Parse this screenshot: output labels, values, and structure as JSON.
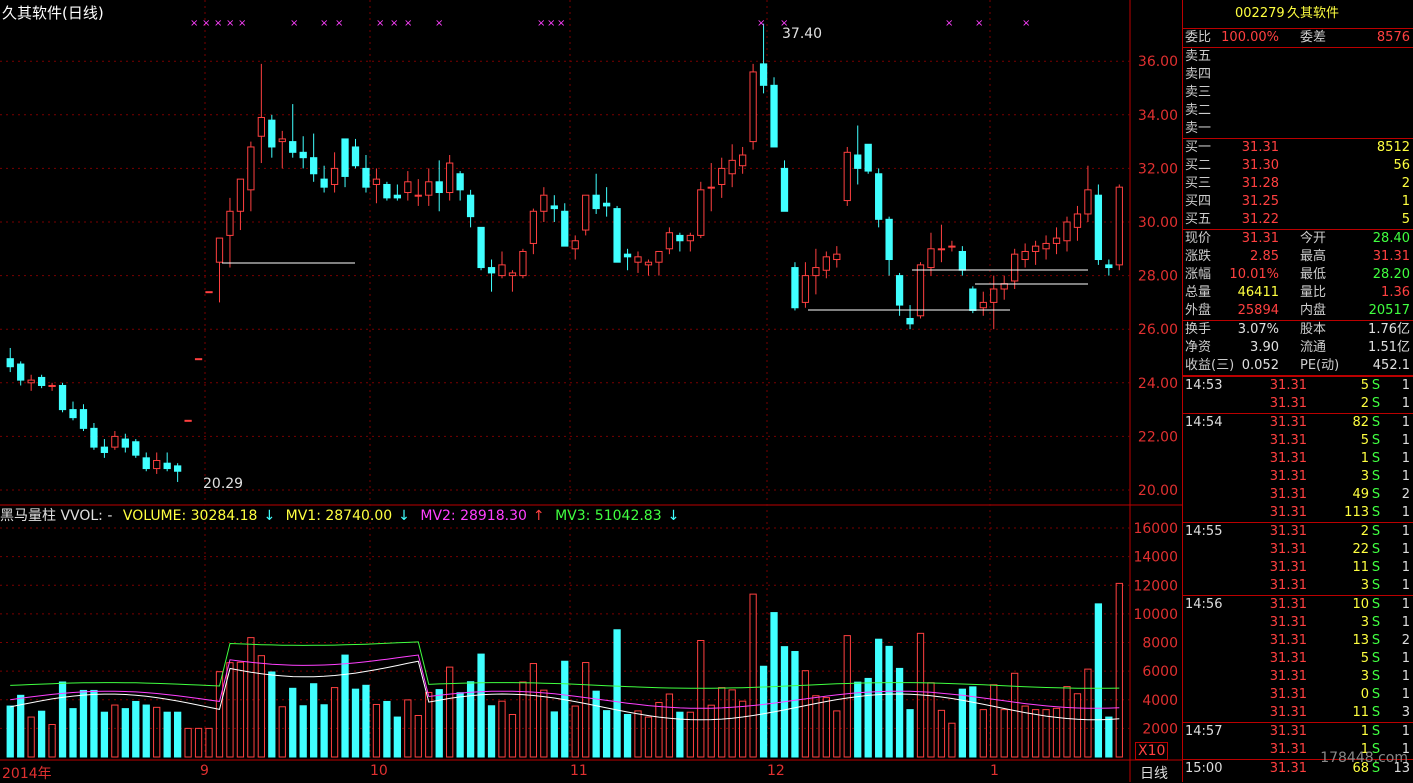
{
  "title": "久其软件(日线)",
  "vol_legend": {
    "name": "黑马量柱 VVOL: -",
    "volume": "VOLUME: 30284.18",
    "mv1": "MV1: 28740.00",
    "mv2": "MV2: 28918.30",
    "mv3": "MV3: 51042.83",
    "colors": {
      "volume": "#ffff40",
      "mv1": "#ffff40",
      "mv2": "#ff40ff",
      "mv3": "#40ff40"
    }
  },
  "annotations": {
    "high": "37.40",
    "low": "20.29"
  },
  "x_labels": [
    "2014年",
    "9",
    "10",
    "11",
    "12",
    "1"
  ],
  "period_label": "日线",
  "x10_label": "X10",
  "price_axis": [
    "36.00",
    "34.00",
    "32.00",
    "30.00",
    "28.00",
    "26.00",
    "24.00",
    "22.00",
    "20.00"
  ],
  "vol_axis": [
    "16000",
    "14000",
    "12000",
    "10000",
    "8000",
    "6000",
    "4000",
    "2000"
  ],
  "chart_data": {
    "type": "candlestick",
    "price_range": [
      20,
      37.4
    ],
    "series": [
      [
        24.9,
        25.3,
        24.4,
        24.6
      ],
      [
        24.7,
        24.8,
        23.9,
        24.1
      ],
      [
        24.0,
        24.3,
        23.7,
        24.1
      ],
      [
        24.2,
        24.3,
        23.8,
        23.9
      ],
      [
        23.9,
        24.0,
        23.7,
        23.9
      ],
      [
        23.9,
        24.0,
        22.9,
        23.0
      ],
      [
        23.0,
        23.3,
        22.6,
        22.7
      ],
      [
        23.0,
        23.2,
        22.2,
        22.3
      ],
      [
        22.3,
        22.5,
        21.5,
        21.6
      ],
      [
        21.6,
        21.9,
        21.2,
        21.4
      ],
      [
        21.6,
        22.2,
        21.5,
        22.0
      ],
      [
        21.9,
        22.1,
        21.4,
        21.6
      ],
      [
        21.8,
        21.9,
        21.2,
        21.3
      ],
      [
        21.2,
        21.4,
        20.7,
        20.8
      ],
      [
        20.8,
        21.4,
        20.6,
        21.1
      ],
      [
        21.0,
        21.4,
        20.7,
        20.8
      ],
      [
        20.9,
        21.0,
        20.3,
        20.7
      ],
      [
        22.6,
        22.6,
        22.6,
        22.6
      ],
      [
        24.9,
        24.9,
        24.9,
        24.9
      ],
      [
        27.4,
        27.4,
        27.4,
        27.4
      ],
      [
        28.5,
        28.9,
        27.0,
        29.4
      ],
      [
        29.5,
        30.9,
        28.3,
        30.4
      ],
      [
        30.4,
        31.5,
        29.7,
        31.6
      ],
      [
        31.2,
        33.0,
        30.4,
        32.8
      ],
      [
        33.2,
        35.9,
        32.2,
        33.9
      ],
      [
        33.8,
        34.0,
        32.4,
        32.8
      ],
      [
        33.0,
        33.4,
        32.0,
        33.1
      ],
      [
        33.0,
        34.4,
        32.4,
        32.6
      ],
      [
        32.6,
        33.2,
        32.0,
        32.4
      ],
      [
        32.4,
        33.3,
        31.5,
        31.8
      ],
      [
        31.6,
        32.1,
        31.1,
        31.3
      ],
      [
        31.4,
        32.6,
        31.1,
        32.0
      ],
      [
        33.1,
        33.1,
        31.3,
        31.7
      ],
      [
        32.8,
        33.1,
        32.0,
        32.1
      ],
      [
        32.0,
        32.5,
        31.1,
        31.3
      ],
      [
        31.4,
        32.0,
        30.7,
        31.6
      ],
      [
        31.4,
        31.5,
        30.8,
        30.9
      ],
      [
        31.0,
        31.4,
        30.8,
        30.9
      ],
      [
        31.1,
        31.9,
        30.8,
        31.5
      ],
      [
        31.0,
        31.6,
        30.6,
        31.0
      ],
      [
        31.0,
        32.0,
        30.6,
        31.5
      ],
      [
        31.5,
        32.3,
        30.4,
        31.1
      ],
      [
        31.1,
        32.5,
        30.8,
        32.2
      ],
      [
        31.8,
        31.9,
        30.8,
        31.2
      ],
      [
        31.0,
        31.2,
        29.8,
        30.2
      ],
      [
        29.8,
        29.8,
        28.2,
        28.3
      ],
      [
        28.3,
        28.6,
        27.4,
        28.1
      ],
      [
        28.0,
        28.9,
        27.9,
        28.4
      ],
      [
        28.0,
        28.2,
        27.4,
        28.1
      ],
      [
        28.0,
        29.0,
        27.9,
        28.9
      ],
      [
        29.2,
        30.5,
        28.8,
        30.4
      ],
      [
        30.4,
        31.3,
        30.0,
        31.0
      ],
      [
        30.6,
        31.0,
        30.0,
        30.5
      ],
      [
        30.4,
        30.7,
        29.1,
        29.1
      ],
      [
        29.0,
        29.5,
        28.6,
        29.3
      ],
      [
        29.7,
        31.0,
        29.5,
        31.0
      ],
      [
        31.0,
        31.8,
        30.3,
        30.5
      ],
      [
        30.7,
        31.3,
        30.2,
        30.6
      ],
      [
        30.5,
        30.6,
        28.5,
        28.5
      ],
      [
        28.8,
        29.0,
        28.2,
        28.7
      ],
      [
        28.5,
        28.9,
        28.1,
        28.7
      ],
      [
        28.4,
        28.6,
        28.0,
        28.5
      ],
      [
        28.5,
        28.9,
        28.0,
        28.9
      ],
      [
        29.0,
        29.8,
        28.8,
        29.6
      ],
      [
        29.5,
        29.6,
        28.9,
        29.3
      ],
      [
        29.3,
        29.6,
        28.9,
        29.5
      ],
      [
        29.5,
        31.5,
        29.4,
        31.2
      ],
      [
        31.3,
        32.2,
        30.4,
        31.3
      ],
      [
        31.4,
        32.4,
        30.9,
        32.0
      ],
      [
        31.8,
        32.9,
        31.3,
        32.3
      ],
      [
        32.1,
        32.8,
        31.8,
        32.5
      ],
      [
        33.0,
        35.9,
        32.7,
        35.6
      ],
      [
        35.9,
        37.4,
        34.8,
        35.1
      ],
      [
        35.1,
        35.4,
        32.8,
        32.8
      ],
      [
        32.0,
        32.3,
        30.4,
        30.4
      ],
      [
        28.3,
        28.5,
        26.7,
        26.8
      ],
      [
        27.0,
        28.5,
        26.8,
        28.0
      ],
      [
        28.0,
        29.0,
        27.3,
        28.3
      ],
      [
        28.2,
        28.9,
        27.9,
        28.7
      ],
      [
        28.6,
        29.1,
        28.3,
        28.8
      ],
      [
        30.8,
        32.8,
        30.6,
        32.6
      ],
      [
        32.5,
        33.6,
        31.4,
        32.0
      ],
      [
        32.9,
        32.9,
        31.8,
        31.9
      ],
      [
        31.8,
        32.0,
        29.8,
        30.1
      ],
      [
        30.1,
        30.2,
        28.0,
        28.6
      ],
      [
        28.0,
        28.1,
        26.5,
        26.9
      ],
      [
        26.4,
        26.9,
        26.0,
        26.2
      ],
      [
        26.5,
        28.5,
        26.4,
        28.4
      ],
      [
        28.3,
        29.6,
        28.0,
        29.0
      ],
      [
        29.0,
        29.9,
        28.5,
        29.0
      ],
      [
        29.1,
        29.3,
        28.9,
        29.1
      ],
      [
        28.9,
        29.1,
        28.0,
        28.2
      ],
      [
        27.5,
        27.6,
        26.6,
        26.7
      ],
      [
        26.8,
        27.4,
        26.5,
        27.0
      ],
      [
        27.0,
        28.0,
        26.0,
        27.5
      ],
      [
        27.5,
        28.0,
        27.1,
        27.7
      ],
      [
        27.8,
        29.0,
        27.5,
        28.8
      ],
      [
        28.6,
        29.2,
        28.3,
        28.9
      ],
      [
        28.9,
        29.3,
        28.4,
        29.1
      ],
      [
        29.0,
        29.5,
        28.6,
        29.2
      ],
      [
        29.2,
        29.8,
        28.8,
        29.4
      ],
      [
        29.3,
        30.2,
        28.9,
        30.0
      ],
      [
        29.8,
        30.6,
        29.3,
        30.3
      ],
      [
        30.3,
        32.1,
        30.0,
        31.2
      ],
      [
        31.0,
        31.4,
        28.4,
        28.6
      ],
      [
        28.4,
        28.6,
        28.0,
        28.3
      ],
      [
        28.4,
        31.4,
        28.2,
        31.3
      ]
    ],
    "vol_range": [
      0,
      16000
    ],
    "ylabel": "",
    "xlabel": ""
  },
  "panel": {
    "code": "002279",
    "name": "久其软件",
    "weibi_label": "委比",
    "weibi": "100.00%",
    "weicha_label": "委差",
    "weicha": "8576",
    "asks": [
      {
        "label": "卖五",
        "price": "",
        "vol": ""
      },
      {
        "label": "卖四",
        "price": "",
        "vol": ""
      },
      {
        "label": "卖三",
        "price": "",
        "vol": ""
      },
      {
        "label": "卖二",
        "price": "",
        "vol": ""
      },
      {
        "label": "卖一",
        "price": "",
        "vol": ""
      }
    ],
    "bids": [
      {
        "label": "买一",
        "price": "31.31",
        "vol": "8512"
      },
      {
        "label": "买二",
        "price": "31.30",
        "vol": "56"
      },
      {
        "label": "买三",
        "price": "31.28",
        "vol": "2"
      },
      {
        "label": "买四",
        "price": "31.25",
        "vol": "1"
      },
      {
        "label": "买五",
        "price": "31.22",
        "vol": "5"
      }
    ],
    "stats1": [
      {
        "l1": "现价",
        "v1": "31.31",
        "c1": "red",
        "l2": "今开",
        "v2": "28.40",
        "c2": "green"
      },
      {
        "l1": "涨跌",
        "v1": "2.85",
        "c1": "red",
        "l2": "最高",
        "v2": "31.31",
        "c2": "red"
      },
      {
        "l1": "涨幅",
        "v1": "10.01%",
        "c1": "red",
        "l2": "最低",
        "v2": "28.20",
        "c2": "green"
      },
      {
        "l1": "总量",
        "v1": "46411",
        "c1": "yellow",
        "l2": "量比",
        "v2": "1.36",
        "c2": "red"
      },
      {
        "l1": "外盘",
        "v1": "25894",
        "c1": "red",
        "l2": "内盘",
        "v2": "20517",
        "c2": "green"
      }
    ],
    "stats2": [
      {
        "l1": "换手",
        "v1": "3.07%",
        "l2": "股本",
        "v2": "1.76亿"
      },
      {
        "l1": "净资",
        "v1": "3.90",
        "l2": "流通",
        "v2": "1.51亿"
      },
      {
        "l1": "收益(三)",
        "v1": "0.052",
        "l2": "PE(动)",
        "v2": "452.1"
      }
    ],
    "ticks": [
      {
        "t": "14:53",
        "p": "31.31",
        "v": "5",
        "bs": "S",
        "n": "1"
      },
      {
        "t": "",
        "p": "31.31",
        "v": "2",
        "bs": "S",
        "n": "1"
      },
      {
        "t": "14:54",
        "p": "31.31",
        "v": "82",
        "bs": "S",
        "n": "1"
      },
      {
        "t": "",
        "p": "31.31",
        "v": "5",
        "bs": "S",
        "n": "1"
      },
      {
        "t": "",
        "p": "31.31",
        "v": "1",
        "bs": "S",
        "n": "1"
      },
      {
        "t": "",
        "p": "31.31",
        "v": "3",
        "bs": "S",
        "n": "1"
      },
      {
        "t": "",
        "p": "31.31",
        "v": "49",
        "bs": "S",
        "n": "2"
      },
      {
        "t": "",
        "p": "31.31",
        "v": "113",
        "bs": "S",
        "n": "1"
      },
      {
        "t": "14:55",
        "p": "31.31",
        "v": "2",
        "bs": "S",
        "n": "1"
      },
      {
        "t": "",
        "p": "31.31",
        "v": "22",
        "bs": "S",
        "n": "1"
      },
      {
        "t": "",
        "p": "31.31",
        "v": "11",
        "bs": "S",
        "n": "1"
      },
      {
        "t": "",
        "p": "31.31",
        "v": "3",
        "bs": "S",
        "n": "1"
      },
      {
        "t": "14:56",
        "p": "31.31",
        "v": "10",
        "bs": "S",
        "n": "1"
      },
      {
        "t": "",
        "p": "31.31",
        "v": "3",
        "bs": "S",
        "n": "1"
      },
      {
        "t": "",
        "p": "31.31",
        "v": "13",
        "bs": "S",
        "n": "2"
      },
      {
        "t": "",
        "p": "31.31",
        "v": "5",
        "bs": "S",
        "n": "1"
      },
      {
        "t": "",
        "p": "31.31",
        "v": "3",
        "bs": "S",
        "n": "1"
      },
      {
        "t": "",
        "p": "31.31",
        "v": "0",
        "bs": "S",
        "n": "1"
      },
      {
        "t": "",
        "p": "31.31",
        "v": "11",
        "bs": "S",
        "n": "3"
      },
      {
        "t": "14:57",
        "p": "31.31",
        "v": "1",
        "bs": "S",
        "n": "1"
      },
      {
        "t": "",
        "p": "31.31",
        "v": "1",
        "bs": "S",
        "n": "1"
      },
      {
        "t": "15:00",
        "p": "31.31",
        "v": "68",
        "bs": "S",
        "n": "13"
      }
    ],
    "watermark": "178448.com"
  }
}
